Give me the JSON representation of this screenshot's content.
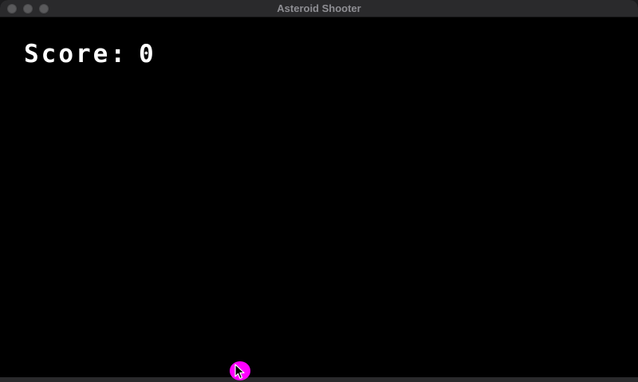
{
  "window": {
    "title": "Asteroid Shooter"
  },
  "hud": {
    "score_label": "Score:",
    "score_value": "0"
  },
  "colors": {
    "background": "#000000",
    "text": "#ffffff",
    "cursor_highlight": "#ff00ff"
  },
  "icons": {
    "cursor": "arrow-cursor-icon"
  }
}
